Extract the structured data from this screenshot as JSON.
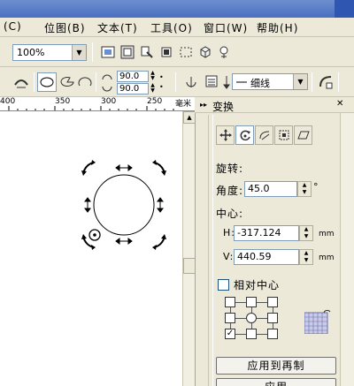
{
  "menu": {
    "items": [
      {
        "label": "(C)"
      },
      {
        "label": "位图(B)"
      },
      {
        "label": "文本(T)"
      },
      {
        "label": "工具(O)"
      },
      {
        "label": "窗口(W)"
      },
      {
        "label": "帮助(H)"
      }
    ]
  },
  "toolbar": {
    "zoom_value": "100%",
    "spin1_value": "90.0",
    "spin2_value": "90.0",
    "line_style": "细线"
  },
  "ruler": {
    "ticks": [
      "400",
      "350",
      "300",
      "250"
    ],
    "unit": "毫米"
  },
  "docker": {
    "title": "变换",
    "section_label": "旋转:",
    "angle_label": "角度:",
    "angle_value": "45.0",
    "angle_unit": "°",
    "center_label": "中心:",
    "h_label": "H:",
    "h_value": "-317.124",
    "h_unit": "mm",
    "v_label": "V:",
    "v_value": "440.59",
    "v_unit": "mm",
    "relative_center_label": "相对中心",
    "apply_duplicate_label": "应用到再制",
    "apply_label": "应用"
  }
}
